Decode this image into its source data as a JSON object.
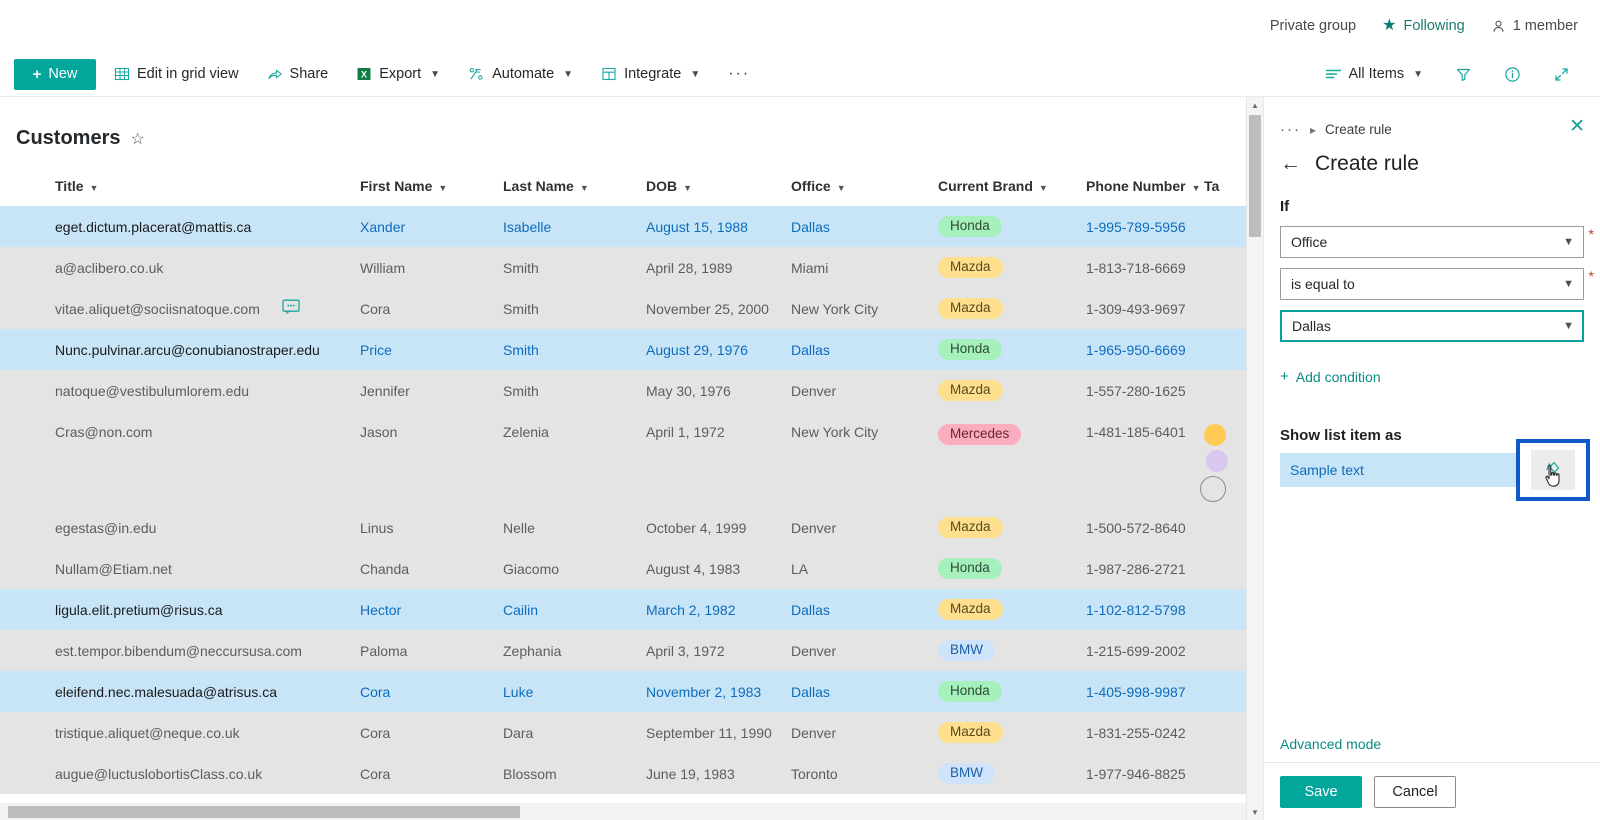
{
  "sitebar": {
    "privacy": "Private group",
    "following": "Following",
    "members": "1 member"
  },
  "commandbar": {
    "new": "New",
    "edit_grid": "Edit in grid view",
    "share": "Share",
    "export": "Export",
    "automate": "Automate",
    "integrate": "Integrate",
    "overflow": "···",
    "view": "All Items"
  },
  "list": {
    "title": "Customers",
    "columns": [
      "Title",
      "First Name",
      "Last Name",
      "DOB",
      "Office",
      "Current Brand",
      "Phone Number",
      "Ta"
    ],
    "rows": [
      {
        "title": "eget.dictum.placerat@mattis.ca",
        "first": "Xander",
        "last": "Isabelle",
        "dob": "August 15, 1988",
        "office": "Dallas",
        "brand": "Honda",
        "brand_class": "honda",
        "phone": "1-995-789-5956",
        "selected": true,
        "comment": false,
        "tall": false,
        "tag": ""
      },
      {
        "title": "a@aclibero.co.uk",
        "first": "William",
        "last": "Smith",
        "dob": "April 28, 1989",
        "office": "Miami",
        "brand": "Mazda",
        "brand_class": "mazda",
        "phone": "1-813-718-6669",
        "selected": false,
        "comment": false,
        "tall": false,
        "tag": ""
      },
      {
        "title": "vitae.aliquet@sociisnatoque.com",
        "first": "Cora",
        "last": "Smith",
        "dob": "November 25, 2000",
        "office": "New York City",
        "brand": "Mazda",
        "brand_class": "mazda",
        "phone": "1-309-493-9697",
        "selected": false,
        "comment": true,
        "tall": false,
        "tag": ""
      },
      {
        "title": "Nunc.pulvinar.arcu@conubianostraper.edu",
        "first": "Price",
        "last": "Smith",
        "dob": "August 29, 1976",
        "office": "Dallas",
        "brand": "Honda",
        "brand_class": "honda",
        "phone": "1-965-950-6669",
        "selected": true,
        "comment": false,
        "tall": false,
        "tag": ""
      },
      {
        "title": "natoque@vestibulumlorem.edu",
        "first": "Jennifer",
        "last": "Smith",
        "dob": "May 30, 1976",
        "office": "Denver",
        "brand": "Mazda",
        "brand_class": "mazda",
        "phone": "1-557-280-1625",
        "selected": false,
        "comment": false,
        "tall": false,
        "tag": ""
      },
      {
        "title": "Cras@non.com",
        "first": "Jason",
        "last": "Zelenia",
        "dob": "April 1, 1972",
        "office": "New York City",
        "brand": "Mercedes",
        "brand_class": "mercedes",
        "phone": "1-481-185-6401",
        "selected": false,
        "comment": false,
        "tall": true,
        "tag": "dots"
      },
      {
        "title": "egestas@in.edu",
        "first": "Linus",
        "last": "Nelle",
        "dob": "October 4, 1999",
        "office": "Denver",
        "brand": "Mazda",
        "brand_class": "mazda",
        "phone": "1-500-572-8640",
        "selected": false,
        "comment": false,
        "tall": false,
        "tag": ""
      },
      {
        "title": "Nullam@Etiam.net",
        "first": "Chanda",
        "last": "Giacomo",
        "dob": "August 4, 1983",
        "office": "LA",
        "brand": "Honda",
        "brand_class": "honda",
        "phone": "1-987-286-2721",
        "selected": false,
        "comment": false,
        "tall": false,
        "tag": ""
      },
      {
        "title": "ligula.elit.pretium@risus.ca",
        "first": "Hector",
        "last": "Cailin",
        "dob": "March 2, 1982",
        "office": "Dallas",
        "brand": "Mazda",
        "brand_class": "mazda",
        "phone": "1-102-812-5798",
        "selected": true,
        "comment": false,
        "tall": false,
        "tag": ""
      },
      {
        "title": "est.tempor.bibendum@neccursusa.com",
        "first": "Paloma",
        "last": "Zephania",
        "dob": "April 3, 1972",
        "office": "Denver",
        "brand": "BMW",
        "brand_class": "bmw",
        "phone": "1-215-699-2002",
        "selected": false,
        "comment": false,
        "tall": false,
        "tag": ""
      },
      {
        "title": "eleifend.nec.malesuada@atrisus.ca",
        "first": "Cora",
        "last": "Luke",
        "dob": "November 2, 1983",
        "office": "Dallas",
        "brand": "Honda",
        "brand_class": "honda",
        "phone": "1-405-998-9987",
        "selected": true,
        "comment": false,
        "tall": false,
        "tag": ""
      },
      {
        "title": "tristique.aliquet@neque.co.uk",
        "first": "Cora",
        "last": "Dara",
        "dob": "September 11, 1990",
        "office": "Denver",
        "brand": "Mazda",
        "brand_class": "mazda",
        "phone": "1-831-255-0242",
        "selected": false,
        "comment": false,
        "tall": false,
        "tag": ""
      },
      {
        "title": "augue@luctuslobortisClass.co.uk",
        "first": "Cora",
        "last": "Blossom",
        "dob": "June 19, 1983",
        "office": "Toronto",
        "brand": "BMW",
        "brand_class": "bmw",
        "phone": "1-977-946-8825",
        "selected": false,
        "comment": false,
        "tall": false,
        "tag": ""
      }
    ]
  },
  "panel": {
    "breadcrumb_overflow": "···",
    "breadcrumb_current": "Create rule",
    "heading": "Create rule",
    "if_label": "If",
    "condition_field": "Office",
    "condition_operator": "is equal to",
    "condition_value": "Dallas",
    "add_condition": "Add condition",
    "show_as_label": "Show list item as",
    "sample_text": "Sample text",
    "advanced_mode": "Advanced mode",
    "save": "Save",
    "cancel": "Cancel",
    "required_mark": "*"
  },
  "colors": {
    "accent": "#03a69a",
    "selected_row": "#c7e5f7",
    "alt_row": "#e4e4e4",
    "focus_border": "#06a29a",
    "highlight_box": "#1059c9",
    "link": "#0f6cbd"
  }
}
